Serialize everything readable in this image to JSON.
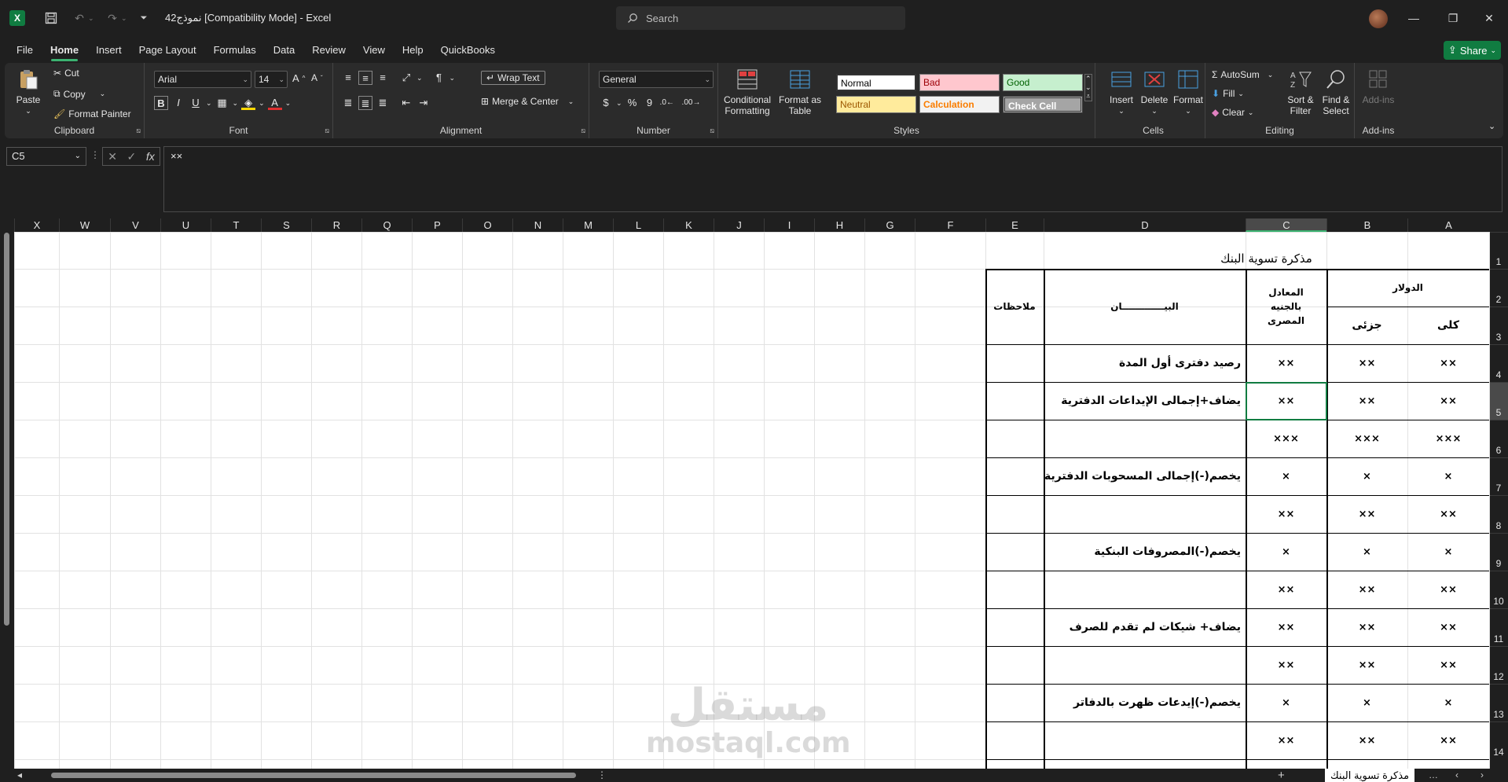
{
  "titlebar": {
    "doc_title": "نموذج42  [Compatibility Mode]  -  Excel",
    "search_placeholder": "Search"
  },
  "tabs": [
    "File",
    "Home",
    "Insert",
    "Page Layout",
    "Formulas",
    "Data",
    "Review",
    "View",
    "Help",
    "QuickBooks"
  ],
  "share_label": "Share",
  "ribbon": {
    "clipboard": {
      "paste": "Paste",
      "cut": "Cut",
      "copy": "Copy",
      "format_painter": "Format Painter",
      "label": "Clipboard"
    },
    "font": {
      "font_name": "Arial",
      "font_size": "14",
      "label": "Font"
    },
    "alignment": {
      "wrap_text": "Wrap Text",
      "merge_center": "Merge & Center",
      "label": "Alignment"
    },
    "number": {
      "format": "General",
      "label": "Number"
    },
    "styles": {
      "conditional": "Conditional Formatting",
      "format_table": "Format as Table",
      "normal": "Normal",
      "bad": "Bad",
      "good": "Good",
      "neutral": "Neutral",
      "calculation": "Calculation",
      "check_cell": "Check Cell",
      "label": "Styles"
    },
    "cells": {
      "insert": "Insert",
      "delete": "Delete",
      "format": "Format",
      "label": "Cells"
    },
    "editing": {
      "autosum": "AutoSum",
      "fill": "Fill",
      "clear": "Clear",
      "sort_filter": "Sort & Filter",
      "find_select": "Find & Select",
      "label": "Editing"
    },
    "addins": {
      "addins": "Add-ins",
      "label": "Add-ins"
    }
  },
  "formula_bar": {
    "name_box": "C5",
    "formula": "××"
  },
  "columns": [
    "X",
    "W",
    "V",
    "U",
    "T",
    "S",
    "R",
    "Q",
    "P",
    "O",
    "N",
    "M",
    "L",
    "K",
    "J",
    "I",
    "H",
    "G",
    "F",
    "E",
    "D",
    "C",
    "B",
    "A"
  ],
  "rows": [
    "1",
    "2",
    "3",
    "4",
    "5",
    "6",
    "7",
    "8",
    "9",
    "10",
    "11",
    "12",
    "13",
    "14"
  ],
  "sheet": {
    "title": "مذكرة تسوية البنك",
    "header_dollar": "الدولار",
    "header_egp": "المعادل بالجنيه المصرى",
    "header_statement": "البيـــــــــــــان",
    "header_notes": "ملاحظات",
    "header_total": "كلى",
    "header_partial": "جزئى",
    "statements": [
      "رصيد دفترى أول المدة",
      "يضاف+إجمالى الإيداعات الدفترية",
      "",
      "يخصم(-)إجمالى المسحوبات الدفترية",
      "",
      "يخصم(-)المصروفات البنكية",
      "",
      "يضاف+ شيكات لم تقدم للصرف",
      "",
      "يخصم(-)إيدعات ظهرت بالدفاتر",
      ""
    ],
    "values": [
      "××",
      "××",
      "×××",
      "×",
      "××",
      "×",
      "××",
      "××",
      "××",
      "×",
      "××"
    ]
  },
  "watermark": {
    "arabic": "مستقل",
    "latin": "mostaql.com"
  },
  "sheet_tab": "مذكرة تسوية البنك"
}
